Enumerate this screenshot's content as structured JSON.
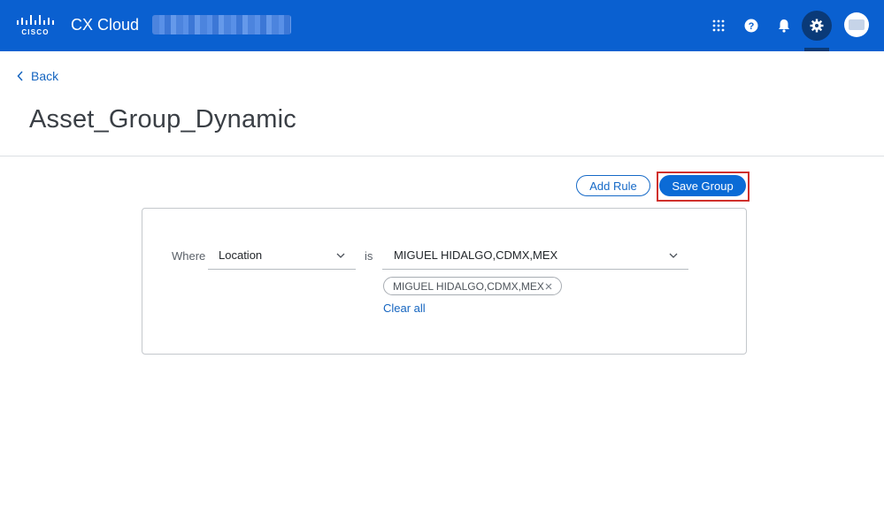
{
  "header": {
    "app_title": "CX Cloud",
    "icons": [
      "apps-grid-icon",
      "help-icon",
      "notification-bell-icon",
      "settings-gear-icon",
      "user-avatar"
    ],
    "colors": {
      "bar": "#0a60d0",
      "active_icon_bg": "#0a3a78"
    }
  },
  "nav": {
    "back_label": "Back"
  },
  "page": {
    "title": "Asset_Group_Dynamic"
  },
  "actions": {
    "add_rule_label": "Add Rule",
    "save_group_label": "Save Group"
  },
  "rule": {
    "where_label": "Where",
    "field_value": "Location",
    "operator_label": "is",
    "value_selected": "MIGUEL HIDALGO,CDMX,MEX",
    "chips": [
      "MIGUEL HIDALGO,CDMX,MEX"
    ],
    "clear_all_label": "Clear all"
  },
  "colors": {
    "accent": "#0b6bd6",
    "link": "#1565c0",
    "highlight": "#d0302c"
  }
}
